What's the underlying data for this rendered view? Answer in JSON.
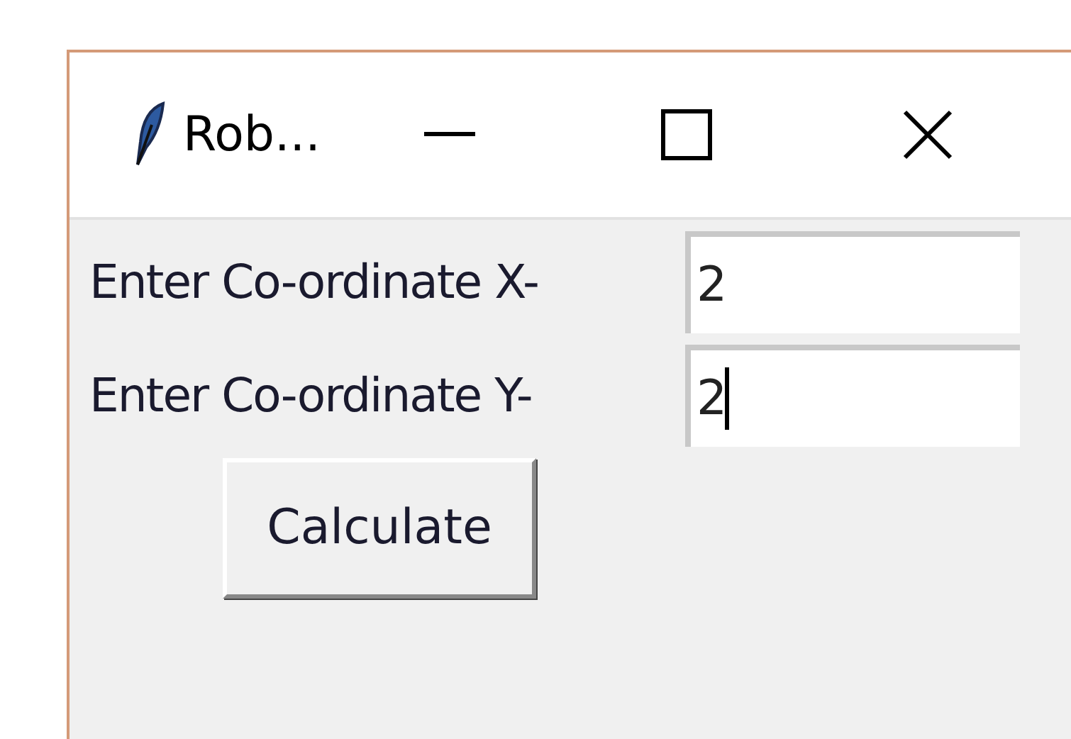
{
  "window": {
    "title": "Rob..."
  },
  "fields": [
    {
      "label": "Enter Co-ordinate X-",
      "value": "2",
      "focused": false
    },
    {
      "label": "Enter Co-ordinate Y-",
      "value": "2",
      "focused": true
    }
  ],
  "button": {
    "label": "Calculate"
  }
}
